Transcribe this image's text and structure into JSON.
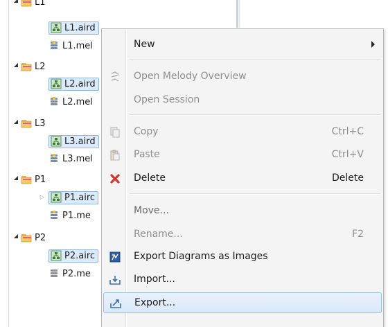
{
  "tree": {
    "folders": [
      {
        "name": "L1",
        "aird": "L1.aird",
        "mel": "L1.mel"
      },
      {
        "name": "L2",
        "aird": "L2.aird",
        "mel": "L2.mel"
      },
      {
        "name": "L3",
        "aird": "L3.aird",
        "mel": "L3.mel"
      },
      {
        "name": "P1",
        "aird": "P1.airc",
        "mel": "P1.me"
      },
      {
        "name": "P2",
        "aird": "P2.airc",
        "mel": "P2.me"
      }
    ]
  },
  "context_menu": {
    "items": {
      "new": {
        "label": "New"
      },
      "open_melody_overview": {
        "label": "Open Melody Overview"
      },
      "open_session": {
        "label": "Open Session"
      },
      "copy": {
        "label": "Copy",
        "accel": "Ctrl+C"
      },
      "paste": {
        "label": "Paste",
        "accel": "Ctrl+V"
      },
      "delete": {
        "label": "Delete",
        "accel": "Delete"
      },
      "move": {
        "label": "Move..."
      },
      "rename": {
        "label": "Rename...",
        "accel": "F2"
      },
      "export_diagrams": {
        "label": "Export Diagrams as Images"
      },
      "import": {
        "label": "Import..."
      },
      "export": {
        "label": "Export..."
      }
    }
  },
  "colors": {
    "selection_fill": "#dcebfb",
    "selection_border": "#8fb6e0",
    "menu_background": "#f4f4f4",
    "disabled_text": "#8e8e8e",
    "delete_icon": "#d9302c"
  }
}
